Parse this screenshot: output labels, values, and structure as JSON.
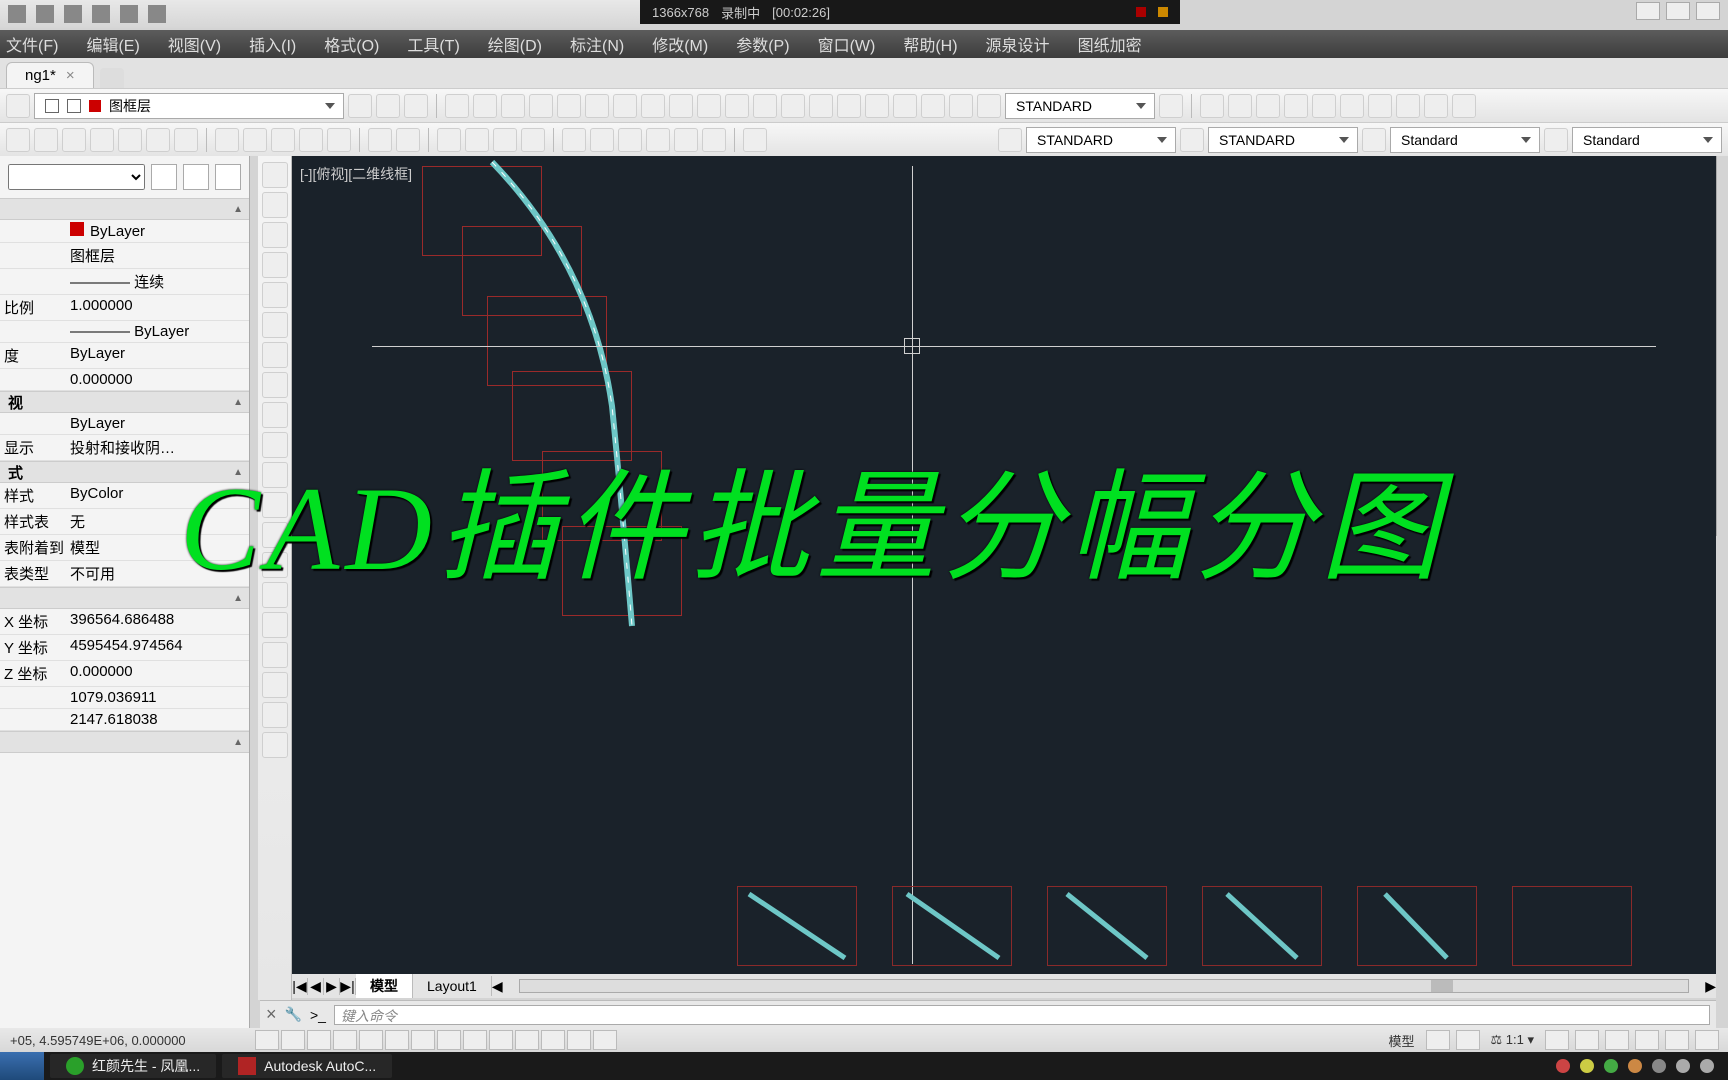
{
  "recording": {
    "resolution": "1366x768",
    "label": "录制中",
    "time": "[00:02:26]"
  },
  "menubar": [
    "文件(F)",
    "编辑(E)",
    "视图(V)",
    "插入(I)",
    "格式(O)",
    "工具(T)",
    "绘图(D)",
    "标注(N)",
    "修改(M)",
    "参数(P)",
    "窗口(W)",
    "帮助(H)",
    "源泉设计",
    "图纸加密"
  ],
  "tab": {
    "name": "ng1*",
    "close": "×"
  },
  "layer_combo": "图框层",
  "styles": {
    "s1": "STANDARD",
    "s2": "STANDARD",
    "s3": "STANDARD",
    "s4": "Standard",
    "s5": "Standard"
  },
  "props": {
    "g1_rows": [
      {
        "k": "",
        "v": "ByLayer",
        "color": true
      },
      {
        "k": "",
        "v": "图框层"
      },
      {
        "k": "",
        "v": "———— 连续"
      },
      {
        "k": "比例",
        "v": "1.000000"
      },
      {
        "k": "",
        "v": "———— ByLayer"
      },
      {
        "k": "度",
        "v": "ByLayer"
      },
      {
        "k": "",
        "v": "0.000000"
      }
    ],
    "g2": "视",
    "g2_rows": [
      {
        "k": "",
        "v": "ByLayer"
      },
      {
        "k": "显示",
        "v": "投射和接收阴…"
      }
    ],
    "g3": "式",
    "g3_rows": [
      {
        "k": "样式",
        "v": "ByColor"
      },
      {
        "k": "样式表",
        "v": "无"
      },
      {
        "k": "表附着到",
        "v": "模型"
      },
      {
        "k": "表类型",
        "v": "不可用"
      }
    ],
    "g4_rows": [
      {
        "k": "X 坐标",
        "v": "396564.686488"
      },
      {
        "k": "Y 坐标",
        "v": "4595454.974564"
      },
      {
        "k": "Z 坐标",
        "v": "0.000000"
      },
      {
        "k": "",
        "v": "1079.036911"
      },
      {
        "k": "",
        "v": "2147.618038"
      }
    ]
  },
  "viewport_label": "[-][俯视][二维线框]",
  "overlay_title": "CAD插件批量分幅分图",
  "layout_tabs": {
    "model": "模型",
    "layout1": "Layout1"
  },
  "cmdline": {
    "prompt": ">_",
    "placeholder": "键入命令"
  },
  "status": {
    "coords": "+05, 4.595749E+06, 0.000000",
    "ms": "模型",
    "scale": "1:1"
  },
  "taskbar": {
    "music": "红颜先生 - 凤凰...",
    "acad": "Autodesk AutoC..."
  }
}
